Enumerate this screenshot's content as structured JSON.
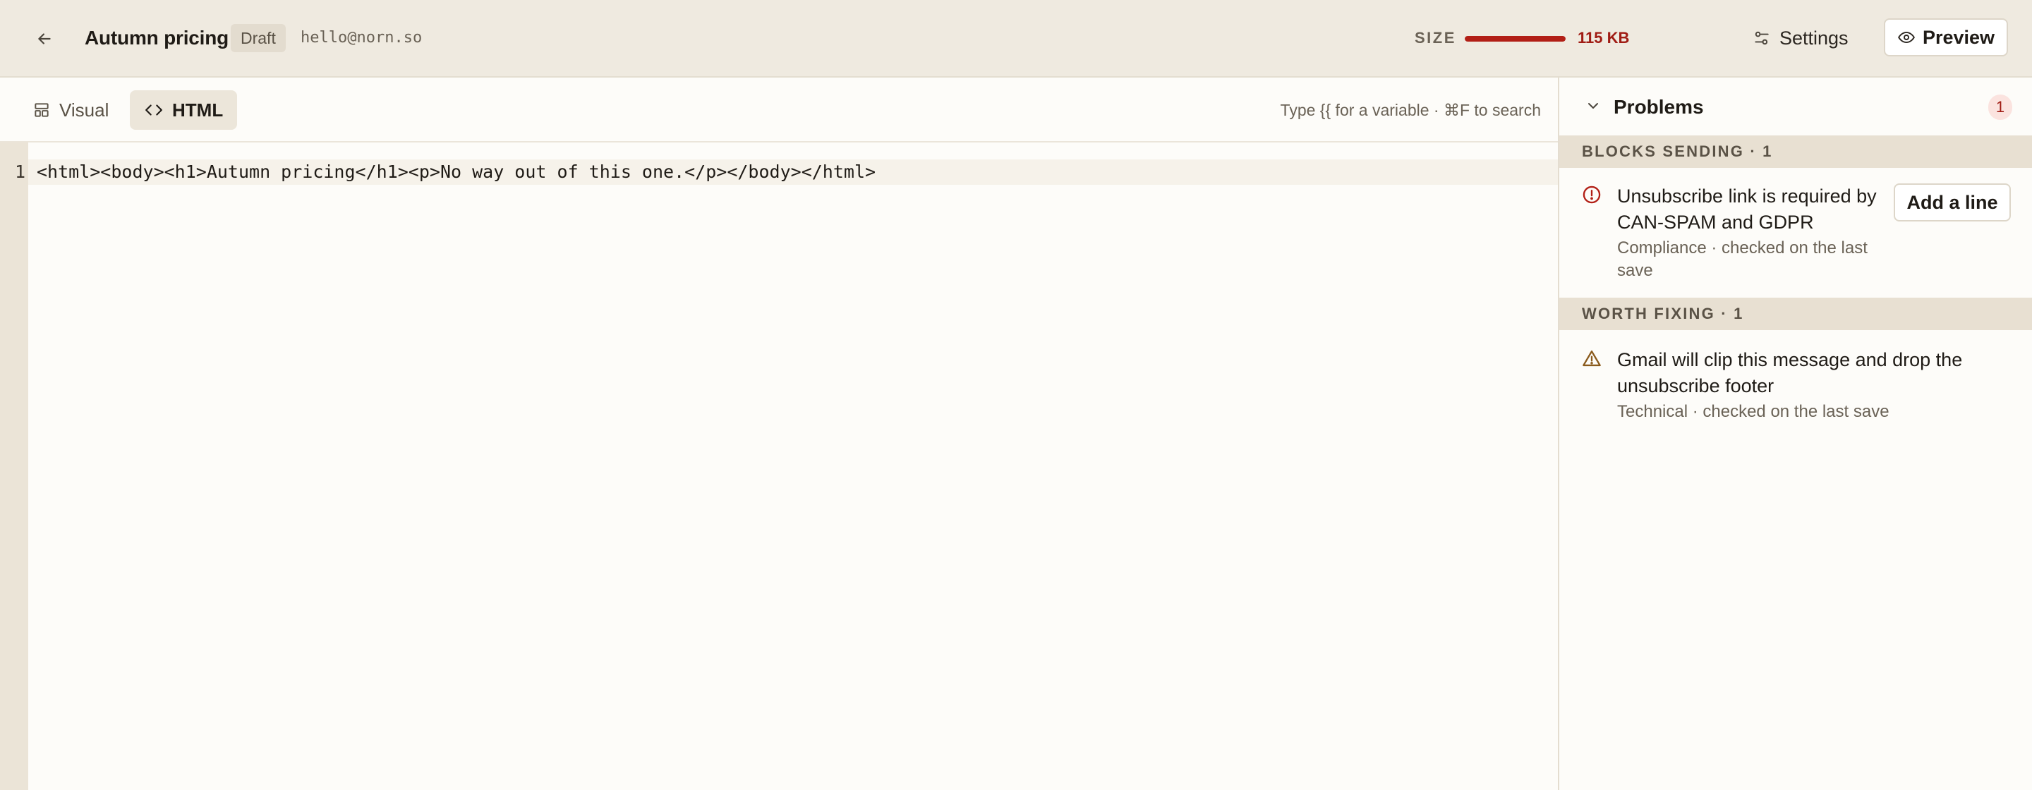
{
  "header": {
    "title": "Autumn pricing",
    "status_badge": "Draft",
    "sender": "hello@norn.so",
    "size_label": "SIZE",
    "size_value": "115 KB",
    "size_fraction": 1.0,
    "settings_label": "Settings",
    "preview_label": "Preview"
  },
  "editor": {
    "tabs": [
      {
        "label": "Visual",
        "active": false
      },
      {
        "label": "HTML",
        "active": true
      }
    ],
    "hint": "Type {{ for a variable · ⌘F to search",
    "lines": [
      {
        "number": "1",
        "code": "<html><body><h1>Autumn pricing</h1><p>No way out of this one.</p></body></html>"
      }
    ]
  },
  "problems": {
    "title": "Problems",
    "count": "1",
    "sections": [
      {
        "heading": "BLOCKS SENDING · 1",
        "issue": {
          "title_line1": "Unsubscribe link is required by",
          "title_line2": "CAN-SPAM and GDPR",
          "meta_line1": "Compliance · checked on the last",
          "meta_line2": "save",
          "action_label": "Add a line",
          "icon": "error-circle-icon"
        }
      },
      {
        "heading": "WORTH FIXING · 1",
        "issue": {
          "title_line1": "Gmail will clip this message and drop the",
          "title_line2": "unsubscribe footer",
          "meta_line1": "Technical · checked on the last save",
          "icon": "warning-triangle-icon"
        }
      }
    ]
  },
  "colors": {
    "accent_error": "#b21f16",
    "warning": "#8a5a1c",
    "background": "#fdfcf9",
    "topbar": "#efeae0"
  }
}
